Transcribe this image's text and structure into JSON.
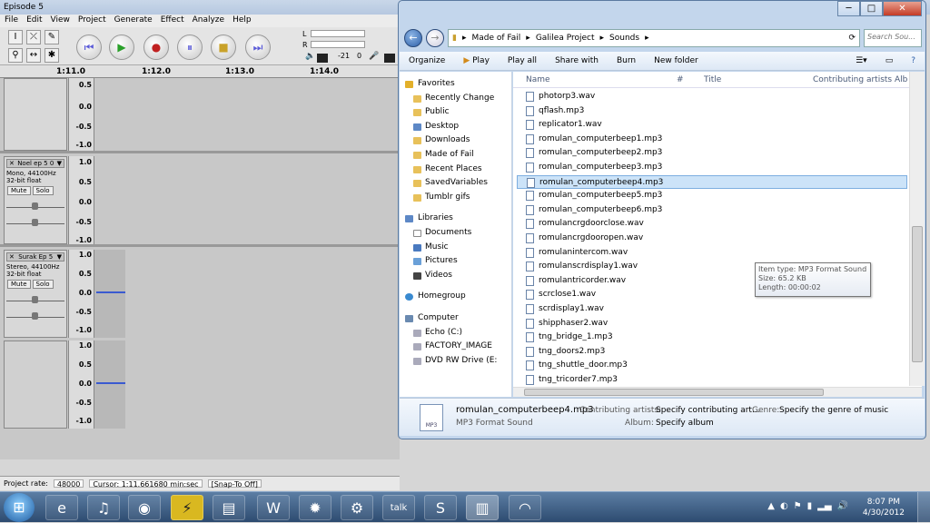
{
  "audacity": {
    "title": "Episode 5",
    "menu": [
      "File",
      "Edit",
      "View",
      "Project",
      "Generate",
      "Effect",
      "Analyze",
      "Help"
    ],
    "meter": {
      "r_label": "R",
      "l_label": "L",
      "db_value": "-21",
      "zero": "0"
    },
    "ruler_ticks": [
      "1:11.0",
      "1:12.0",
      "1:13.0",
      "1:14.0"
    ],
    "tracks": [
      {
        "name": "",
        "info": "",
        "format": "",
        "scale": [
          "0.5",
          "0.0",
          "-0.5",
          "-1.0"
        ]
      },
      {
        "name": "Noel ep 5 0",
        "info": "Mono, 44100Hz",
        "format": "32-bit float",
        "mute": "Mute",
        "solo": "Solo",
        "scale": [
          "1.0",
          "0.5",
          "0.0",
          "-0.5",
          "-1.0"
        ]
      },
      {
        "name": "Surak Ep 5",
        "info": "Stereo, 44100Hz",
        "format": "32-bit float",
        "mute": "Mute",
        "solo": "Solo",
        "scale": [
          "1.0",
          "0.5",
          "0.0",
          "-0.5",
          "-1.0"
        ],
        "scale2": [
          "1.0",
          "0.5",
          "0.0",
          "-0.5",
          "-1.0"
        ]
      }
    ],
    "status": {
      "rate_label": "Project rate:",
      "rate_value": "48000",
      "cursor": "Cursor: 1:11.661680 min:sec",
      "snap": "[Snap-To Off]"
    }
  },
  "explorer": {
    "breadcrumb": [
      "Made of Fail",
      "Galilea Project",
      "Sounds"
    ],
    "search_placeholder": "Search Sou...",
    "toolbar": {
      "organize": "Organize",
      "play": "Play",
      "play_all": "Play all",
      "share": "Share with",
      "burn": "Burn",
      "new_folder": "New folder"
    },
    "nav": {
      "favorites": "Favorites",
      "fav_items": [
        "Recently Change",
        "Public",
        "Desktop",
        "Downloads",
        "Made of Fail",
        "Recent Places",
        "SavedVariables",
        "Tumblr gifs"
      ],
      "libraries": "Libraries",
      "lib_items": [
        "Documents",
        "Music",
        "Pictures",
        "Videos"
      ],
      "homegroup": "Homegroup",
      "computer": "Computer",
      "comp_items": [
        "Echo (C:)",
        "FACTORY_IMAGE",
        "DVD RW Drive (E:"
      ]
    },
    "columns": {
      "name": "Name",
      "num": "#",
      "title": "Title",
      "artists": "Contributing artists",
      "album": "Alb"
    },
    "files": [
      "photorp3.wav",
      "qflash.mp3",
      "replicator1.wav",
      "romulan_computerbeep1.mp3",
      "romulan_computerbeep2.mp3",
      "romulan_computerbeep3.mp3",
      "romulan_computerbeep4.mp3",
      "romulan_computerbeep5.mp3",
      "romulan_computerbeep6.mp3",
      "romulancrgdoorclose.wav",
      "romulancrgdooropen.wav",
      "romulanintercom.wav",
      "romulanscrdisplay1.wav",
      "romulantricorder.wav",
      "scrclose1.wav",
      "scrdisplay1.wav",
      "shipphaser2.wav",
      "tng_bridge_1.mp3",
      "tng_doors2.mp3",
      "tng_shuttle_door.mp3",
      "tng_tricorder7.mp3"
    ],
    "selected_index": 6,
    "tooltip": {
      "type": "Item type: MP3 Format Sound",
      "size": "Size: 65.2 KB",
      "length": "Length: 00:00:02"
    },
    "details": {
      "filename": "romulan_computerbeep4.mp3",
      "filetype": "MP3 Format Sound",
      "artists_label": "Contributing artists:",
      "artists_value": "Specify contributing art...",
      "album_label": "Album:",
      "album_value": "Specify album",
      "genre_label": "Genre:",
      "genre_value": "Specify the genre of music",
      "icon_text": "MP3"
    }
  },
  "taskbar": {
    "apps": [
      "internet-explorer",
      "itunes",
      "chrome",
      "winamp",
      "folder",
      "warcraft",
      "firefox",
      "steam",
      "talk",
      "skype",
      "explorer",
      "headphones"
    ],
    "talk_label": "talk",
    "time": "8:07 PM",
    "date": "4/30/2012"
  }
}
